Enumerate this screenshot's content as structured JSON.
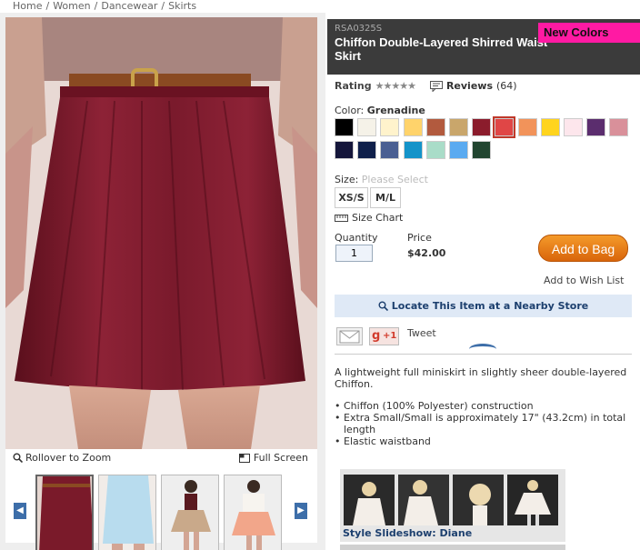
{
  "breadcrumb": [
    "Home",
    "Women",
    "Dancewear",
    "Skirts"
  ],
  "breadcrumb_sep": "/",
  "product": {
    "sku": "RSA0325S",
    "title": "Chiffon Double-Layered Shirred Waist Skirt",
    "badge": "New Colors",
    "rating_label": "Rating",
    "stars": "★★★★★",
    "reviews_label": "Reviews",
    "reviews_count": "(64)",
    "color_label": "Color:",
    "color_value": "Grenadine",
    "swatches": [
      "#000000",
      "#f5f2e8",
      "#fff3cc",
      "#ffd36b",
      "#b25a3e",
      "#c9a66b",
      "#8b1c2c",
      "#e04646",
      "#f2935a",
      "#ffd41e",
      "#fde6ec",
      "#5b2d6e",
      "#d9909a",
      "#15163a",
      "#0f1f4a",
      "#4a5f92",
      "#1493c9",
      "#a9dcc8",
      "#5aaaf0",
      "#21452f"
    ],
    "selected_swatch_index": 7,
    "size_label": "Size:",
    "size_placeholder": "Please Select",
    "sizes": [
      "XS/S",
      "M/L"
    ],
    "size_chart": "Size Chart",
    "quantity_label": "Quantity",
    "quantity_value": "1",
    "price_label": "Price",
    "price_value": "$42.00",
    "add_to_bag": "Add to Bag",
    "wish_list": "Add to Wish List",
    "locate": "Locate This Item at a Nearby Store",
    "gplus": "+1",
    "tweet": "Tweet",
    "description": "A lightweight full miniskirt in slightly sheer double-layered Chiffon.",
    "bullets": [
      "Chiffon (100% Polyester) construction",
      "Extra Small/Small is approximately 17\" (43.2cm) in total length",
      "Elastic waistband"
    ],
    "slideshow_caption": "Style Slideshow: Diane"
  },
  "viewer": {
    "zoom_label": "Rollover to Zoom",
    "fullscreen_label": "Full Screen",
    "thumb_colors": [
      "#7a1a2a",
      "#b8dcee",
      "#c9a98a",
      "#f2a68a"
    ]
  }
}
